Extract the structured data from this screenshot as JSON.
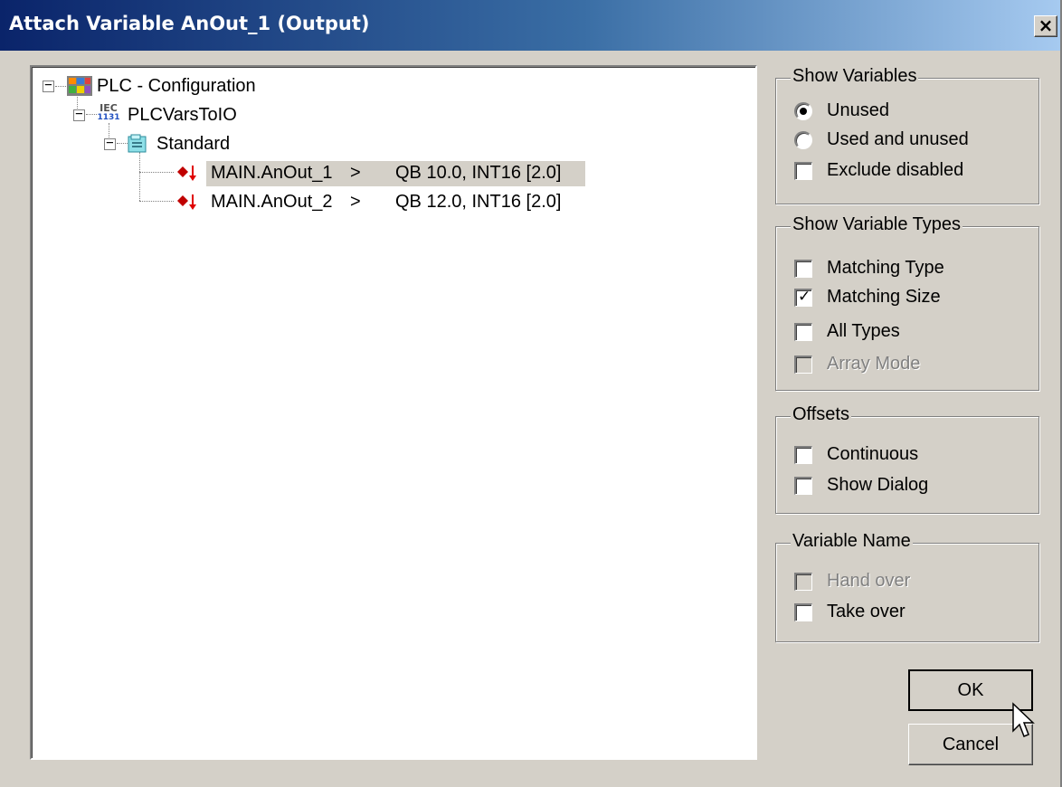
{
  "window": {
    "title": "Attach Variable AnOut_1 (Output)",
    "close_label": "×"
  },
  "tree": {
    "root": {
      "label": "PLC - Configuration",
      "expander": "−"
    },
    "project": {
      "label": "PLCVarsToIO",
      "icon_text_top": "IEC",
      "icon_text_bottom": "1131",
      "expander": "−"
    },
    "folder": {
      "label": "Standard",
      "expander": "−"
    },
    "variables": [
      {
        "name": "MAIN.AnOut_1",
        "arrow": ">",
        "address": "QB 10.0, INT16 [2.0]",
        "selected": true
      },
      {
        "name": "MAIN.AnOut_2",
        "arrow": ">",
        "address": "QB 12.0, INT16 [2.0]",
        "selected": false
      }
    ]
  },
  "show_variables": {
    "legend": "Show Variables",
    "unused": "Unused",
    "used_and_unused": "Used and unused",
    "exclude_disabled": "Exclude disabled",
    "selected": "unused"
  },
  "show_variable_types": {
    "legend": "Show Variable Types",
    "matching_type": "Matching Type",
    "matching_size": "Matching Size",
    "all_types": "All Types",
    "array_mode": "Array Mode"
  },
  "offsets": {
    "legend": "Offsets",
    "continuous": "Continuous",
    "show_dialog": "Show Dialog"
  },
  "variable_name": {
    "legend": "Variable Name",
    "hand_over": "Hand over",
    "take_over": "Take over"
  },
  "buttons": {
    "ok": "OK",
    "cancel": "Cancel"
  },
  "colors": {
    "titlebar_start": "#0a246a",
    "titlebar_end": "#a6caf0",
    "dialog_bg": "#d4d0c8",
    "selection_bg": "#d4d0c8"
  }
}
